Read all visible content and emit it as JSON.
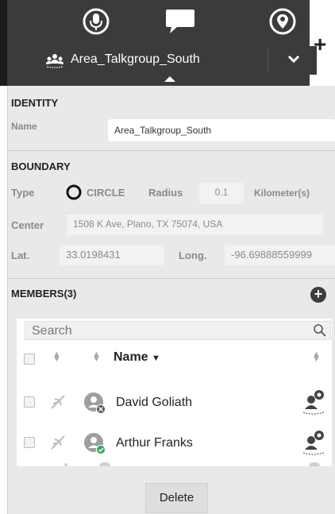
{
  "toolbar": {
    "icons": [
      "microphone-icon",
      "chat-icon",
      "location-icon"
    ],
    "add_label": "+"
  },
  "talkgroup": {
    "name": "Area_Talkgroup_South",
    "icon": "group-icon"
  },
  "identity": {
    "title": "IDENTITY",
    "name_label": "Name",
    "name_value": "Area_Talkgroup_South"
  },
  "boundary": {
    "title": "BOUNDARY",
    "type_label": "Type",
    "type_value": "CIRCLE",
    "radius_label": "Radius",
    "radius_value": "0.1",
    "unit": "Kilometer(s)",
    "center_label": "Center",
    "center_value": "1508 K Ave, Plano, TX 75074, USA",
    "lat_label": "Lat.",
    "lat_value": "33.0198431",
    "long_label": "Long.",
    "long_value": "-96.69888559999"
  },
  "members": {
    "title": "MEMBERS(3)",
    "search_placeholder": "Search",
    "column_name": "Name",
    "rows": [
      {
        "name": "David Goliath",
        "status": "offline"
      },
      {
        "name": "Arthur Franks",
        "status": "online"
      }
    ]
  },
  "actions": {
    "delete_label": "Delete"
  },
  "colors": {
    "header_bg": "#3b3b3b",
    "panel_bg": "#e9e9e9",
    "online": "#2ea84f",
    "offline": "#555555"
  }
}
